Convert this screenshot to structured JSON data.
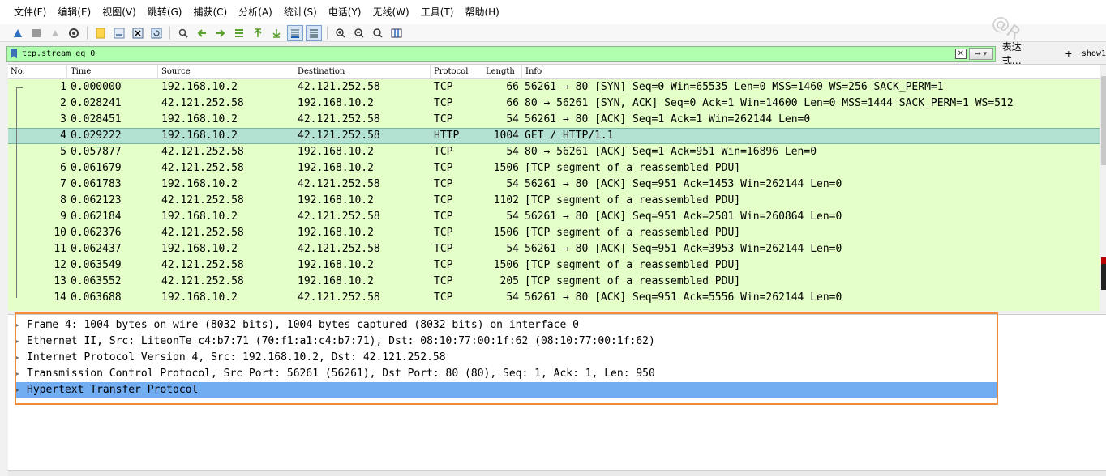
{
  "menu": [
    "文件(F)",
    "编辑(E)",
    "视图(V)",
    "跳转(G)",
    "捕获(C)",
    "分析(A)",
    "统计(S)",
    "电话(Y)",
    "无线(W)",
    "工具(T)",
    "帮助(H)"
  ],
  "filter": {
    "value": "tcp.stream eq 0",
    "expression_label": "表达式…",
    "add_label": "+",
    "show_label": "show1"
  },
  "columns": {
    "no": "No.",
    "time": "Time",
    "source": "Source",
    "destination": "Destination",
    "protocol": "Protocol",
    "length": "Length",
    "info": "Info"
  },
  "packets": [
    {
      "no": "1",
      "time": "0.000000",
      "source": "192.168.10.2",
      "destination": "42.121.252.58",
      "protocol": "TCP",
      "length": "66",
      "info": "56261 → 80 [SYN] Seq=0 Win=65535 Len=0 MSS=1460 WS=256 SACK_PERM=1"
    },
    {
      "no": "2",
      "time": "0.028241",
      "source": "42.121.252.58",
      "destination": "192.168.10.2",
      "protocol": "TCP",
      "length": "66",
      "info": "80 → 56261 [SYN, ACK] Seq=0 Ack=1 Win=14600 Len=0 MSS=1444 SACK_PERM=1 WS=512"
    },
    {
      "no": "3",
      "time": "0.028451",
      "source": "192.168.10.2",
      "destination": "42.121.252.58",
      "protocol": "TCP",
      "length": "54",
      "info": "56261 → 80 [ACK] Seq=1 Ack=1 Win=262144 Len=0"
    },
    {
      "no": "4",
      "time": "0.029222",
      "source": "192.168.10.2",
      "destination": "42.121.252.58",
      "protocol": "HTTP",
      "length": "1004",
      "info": "GET / HTTP/1.1"
    },
    {
      "no": "5",
      "time": "0.057877",
      "source": "42.121.252.58",
      "destination": "192.168.10.2",
      "protocol": "TCP",
      "length": "54",
      "info": "80 → 56261 [ACK] Seq=1 Ack=951 Win=16896 Len=0"
    },
    {
      "no": "6",
      "time": "0.061679",
      "source": "42.121.252.58",
      "destination": "192.168.10.2",
      "protocol": "TCP",
      "length": "1506",
      "info": "[TCP segment of a reassembled PDU]"
    },
    {
      "no": "7",
      "time": "0.061783",
      "source": "192.168.10.2",
      "destination": "42.121.252.58",
      "protocol": "TCP",
      "length": "54",
      "info": "56261 → 80 [ACK] Seq=951 Ack=1453 Win=262144 Len=0"
    },
    {
      "no": "8",
      "time": "0.062123",
      "source": "42.121.252.58",
      "destination": "192.168.10.2",
      "protocol": "TCP",
      "length": "1102",
      "info": "[TCP segment of a reassembled PDU]"
    },
    {
      "no": "9",
      "time": "0.062184",
      "source": "192.168.10.2",
      "destination": "42.121.252.58",
      "protocol": "TCP",
      "length": "54",
      "info": "56261 → 80 [ACK] Seq=951 Ack=2501 Win=260864 Len=0"
    },
    {
      "no": "10",
      "time": "0.062376",
      "source": "42.121.252.58",
      "destination": "192.168.10.2",
      "protocol": "TCP",
      "length": "1506",
      "info": "[TCP segment of a reassembled PDU]"
    },
    {
      "no": "11",
      "time": "0.062437",
      "source": "192.168.10.2",
      "destination": "42.121.252.58",
      "protocol": "TCP",
      "length": "54",
      "info": "56261 → 80 [ACK] Seq=951 Ack=3953 Win=262144 Len=0"
    },
    {
      "no": "12",
      "time": "0.063549",
      "source": "42.121.252.58",
      "destination": "192.168.10.2",
      "protocol": "TCP",
      "length": "1506",
      "info": "[TCP segment of a reassembled PDU]"
    },
    {
      "no": "13",
      "time": "0.063552",
      "source": "42.121.252.58",
      "destination": "192.168.10.2",
      "protocol": "TCP",
      "length": "205",
      "info": "[TCP segment of a reassembled PDU]"
    },
    {
      "no": "14",
      "time": "0.063688",
      "source": "192.168.10.2",
      "destination": "42.121.252.58",
      "protocol": "TCP",
      "length": "54",
      "info": "56261 → 80 [ACK] Seq=951 Ack=5556 Win=262144 Len=0"
    }
  ],
  "selected_packet": "4",
  "details": [
    "Frame 4: 1004 bytes on wire (8032 bits), 1004 bytes captured (8032 bits) on interface 0",
    "Ethernet II, Src: LiteonTe_c4:b7:71 (70:f1:a1:c4:b7:71), Dst: 08:10:77:00:1f:62 (08:10:77:00:1f:62)",
    "Internet Protocol Version 4, Src: 192.168.10.2, Dst: 42.121.252.58",
    "Transmission Control Protocol, Src Port: 56261 (56261), Dst Port: 80 (80), Seq: 1, Ack: 1, Len: 950",
    "Hypertext Transfer Protocol"
  ],
  "selected_detail": 4,
  "watermark": "@R"
}
